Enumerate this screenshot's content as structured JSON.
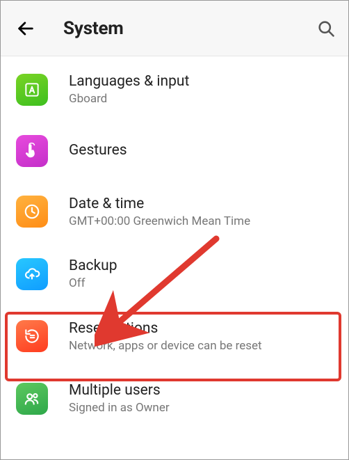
{
  "header": {
    "title": "System"
  },
  "items": [
    {
      "title": "Languages & input",
      "sub": "Gboard"
    },
    {
      "title": "Gestures",
      "sub": ""
    },
    {
      "title": "Date & time",
      "sub": "GMT+00:00 Greenwich Mean Time"
    },
    {
      "title": "Backup",
      "sub": "Off"
    },
    {
      "title": "Reset options",
      "sub": "Network, apps or device can be reset"
    },
    {
      "title": "Multiple users",
      "sub": "Signed in as Owner"
    }
  ],
  "annotation": {
    "highlight_index": 4,
    "arrow_color": "#e0392f"
  }
}
